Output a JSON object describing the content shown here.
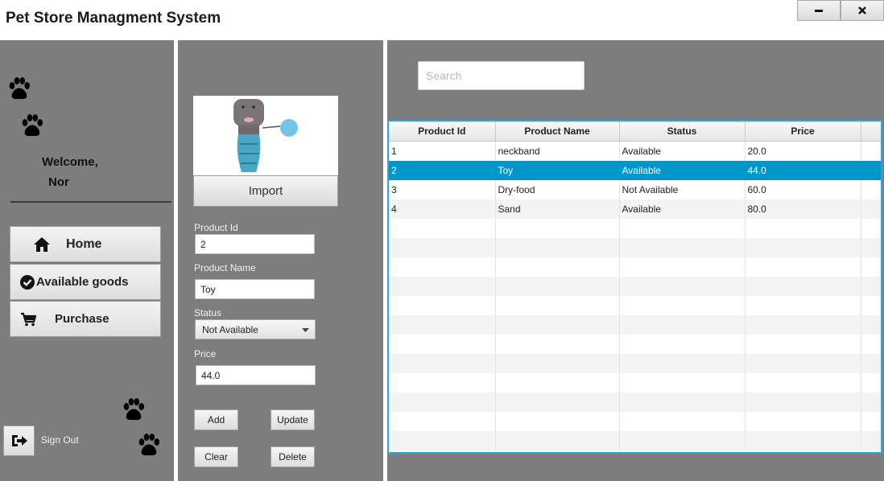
{
  "app": {
    "title": "Pet Store Managment System",
    "minimize_icon": "minimize-icon",
    "close_icon": "close-icon"
  },
  "sidebar": {
    "welcome": "Welcome,",
    "user": "Nor",
    "nav": [
      {
        "label": "Home",
        "icon": "home-icon"
      },
      {
        "label": "Available goods",
        "icon": "check-circle-icon"
      },
      {
        "label": "Purchase",
        "icon": "cart-icon"
      }
    ],
    "signout_label": "Sign Out"
  },
  "form": {
    "import_label": "Import",
    "product_id_label": "Product Id",
    "product_id_value": "2",
    "product_name_label": "Product Name",
    "product_name_value": "Toy",
    "status_label": "Status",
    "status_value": "Not Available",
    "price_label": "Price",
    "price_value": "44.0",
    "add_label": "Add",
    "update_label": "Update",
    "clear_label": "Clear",
    "delete_label": "Delete"
  },
  "search": {
    "placeholder": "Search"
  },
  "table": {
    "columns": [
      "Product Id",
      "Product Name",
      "Status",
      "Price"
    ],
    "rows": [
      [
        "1",
        "neckband",
        "Available",
        "20.0"
      ],
      [
        "2",
        "Toy",
        "Available",
        "44.0"
      ],
      [
        "3",
        "Dry-food",
        "Not Available",
        "60.0"
      ],
      [
        "4",
        "Sand",
        "Available",
        "80.0"
      ]
    ],
    "selected_row": 1
  },
  "colors": {
    "panel": "#7d7d7d",
    "selection": "#0096c9",
    "table_border": "#2ca7d8"
  }
}
